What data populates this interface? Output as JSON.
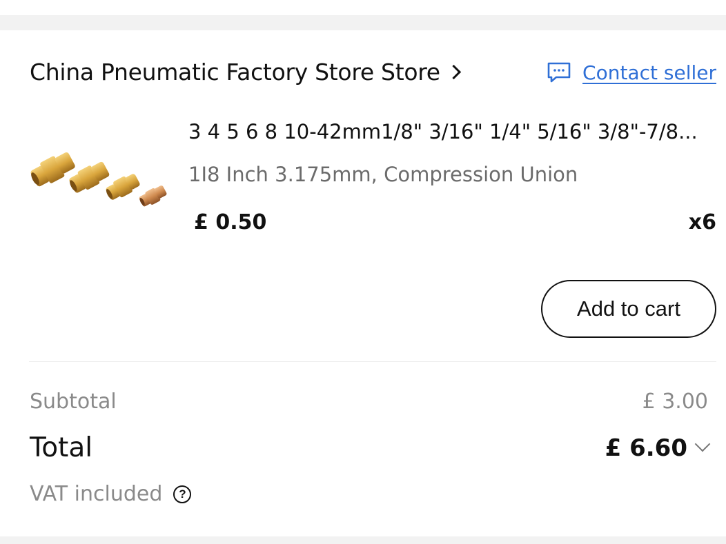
{
  "store": {
    "name": "China Pneumatic Factory Store Store",
    "contact_label": "Contact seller",
    "contact_icon": "chat-icon",
    "accent_color": "#2f6fd6"
  },
  "product": {
    "title": "3 4 5 6 8 10-42mm1/8\" 3/16\" 1/4\" 5/16\" 3/8\"-7/8...",
    "variant": "1I8 Inch 3.175mm, Compression Union",
    "price": "£ 0.50",
    "quantity": "x6",
    "image": "brass-compression-union-fittings"
  },
  "actions": {
    "add_to_cart": "Add to cart"
  },
  "summary": {
    "subtotal_label": "Subtotal",
    "subtotal_value": "£ 3.00",
    "total_label": "Total",
    "total_value": "£ 6.60",
    "vat_label": "VAT included",
    "help_symbol": "?"
  }
}
